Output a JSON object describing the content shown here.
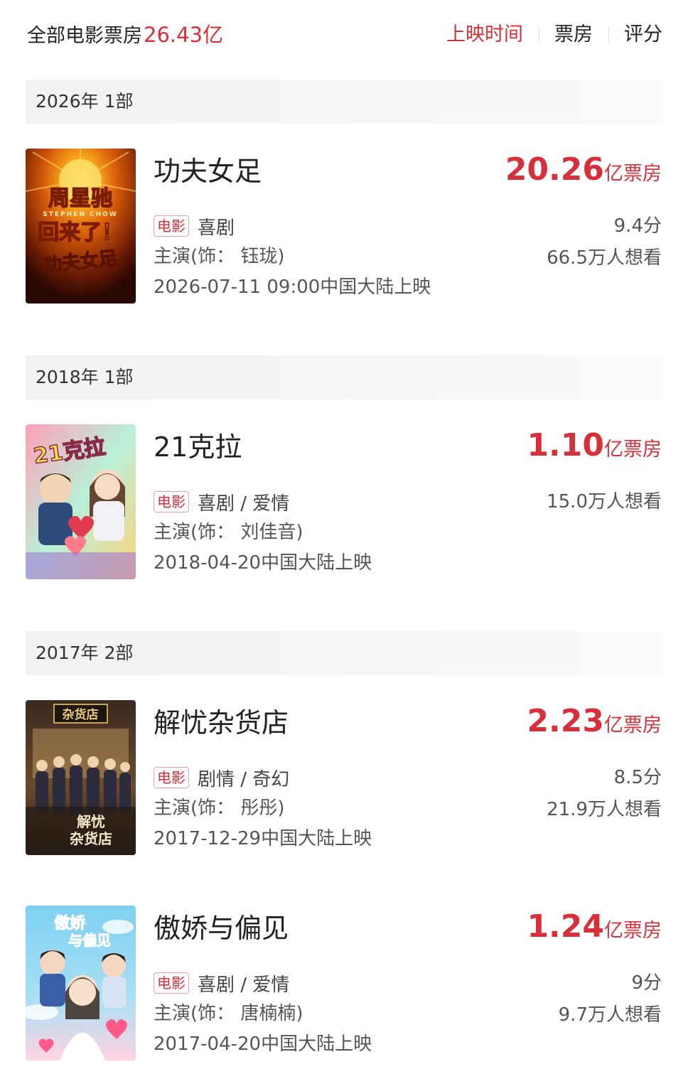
{
  "header": {
    "total_label": "全部电影票房",
    "total_amount": "26.43亿",
    "sort_tabs": [
      {
        "label": "上映时间",
        "active": true
      },
      {
        "label": "票房",
        "active": false
      },
      {
        "label": "评分",
        "active": false
      }
    ]
  },
  "groups": [
    {
      "year_label": "2026年   1部",
      "movies": [
        {
          "title": "功夫女足",
          "tag": "电影",
          "genre": "喜剧",
          "cast": "主演(饰：  钰珑)",
          "release": "2026-07-11 09:00中国大陆上映",
          "box_value": "20.26",
          "box_unit": "亿票房",
          "score": "9.4分",
          "want": "66.5万人想看",
          "poster_text": [
            "周星驰",
            "STEPHEN CHOW",
            "回来了！",
            "功夫女足"
          ],
          "poster_icon": "sun-burst-poster-art"
        }
      ]
    },
    {
      "year_label": "2018年   1部",
      "movies": [
        {
          "title": "21克拉",
          "tag": "电影",
          "genre": "喜剧 / 爱情",
          "cast": "主演(饰：  刘佳音)",
          "release": "2018-04-20中国大陆上映",
          "box_value": "1.10",
          "box_unit": "亿票房",
          "score": "",
          "want": "15.0万人想看",
          "poster_text": [
            "21克拉"
          ],
          "poster_icon": "couple-hearts-poster-art"
        }
      ]
    },
    {
      "year_label": "2017年   2部",
      "movies": [
        {
          "title": "解忧杂货店",
          "tag": "电影",
          "genre": "剧情 / 奇幻",
          "cast": "主演(饰：  彤彤)",
          "release": "2017-12-29中国大陆上映",
          "box_value": "2.23",
          "box_unit": "亿票房",
          "score": "8.5分",
          "want": "21.9万人想看",
          "poster_text": [
            "杂货店",
            "解忧",
            "杂货店"
          ],
          "poster_icon": "storefront-group-poster-art"
        },
        {
          "title": "傲娇与偏见",
          "tag": "电影",
          "genre": "喜剧 / 爱情",
          "cast": "主演(饰：  唐楠楠)",
          "release": "2017-04-20中国大陆上映",
          "box_value": "1.24",
          "box_unit": "亿票房",
          "score": "9分",
          "want": "9.7万人想看",
          "poster_text": [
            "傲娇",
            "与偏见"
          ],
          "poster_icon": "pink-sky-couple-poster-art"
        }
      ]
    }
  ],
  "colors": {
    "accent": "#d8303b",
    "text_primary": "#222222",
    "text_secondary": "#555555",
    "year_bar": "#f2f2f2"
  }
}
